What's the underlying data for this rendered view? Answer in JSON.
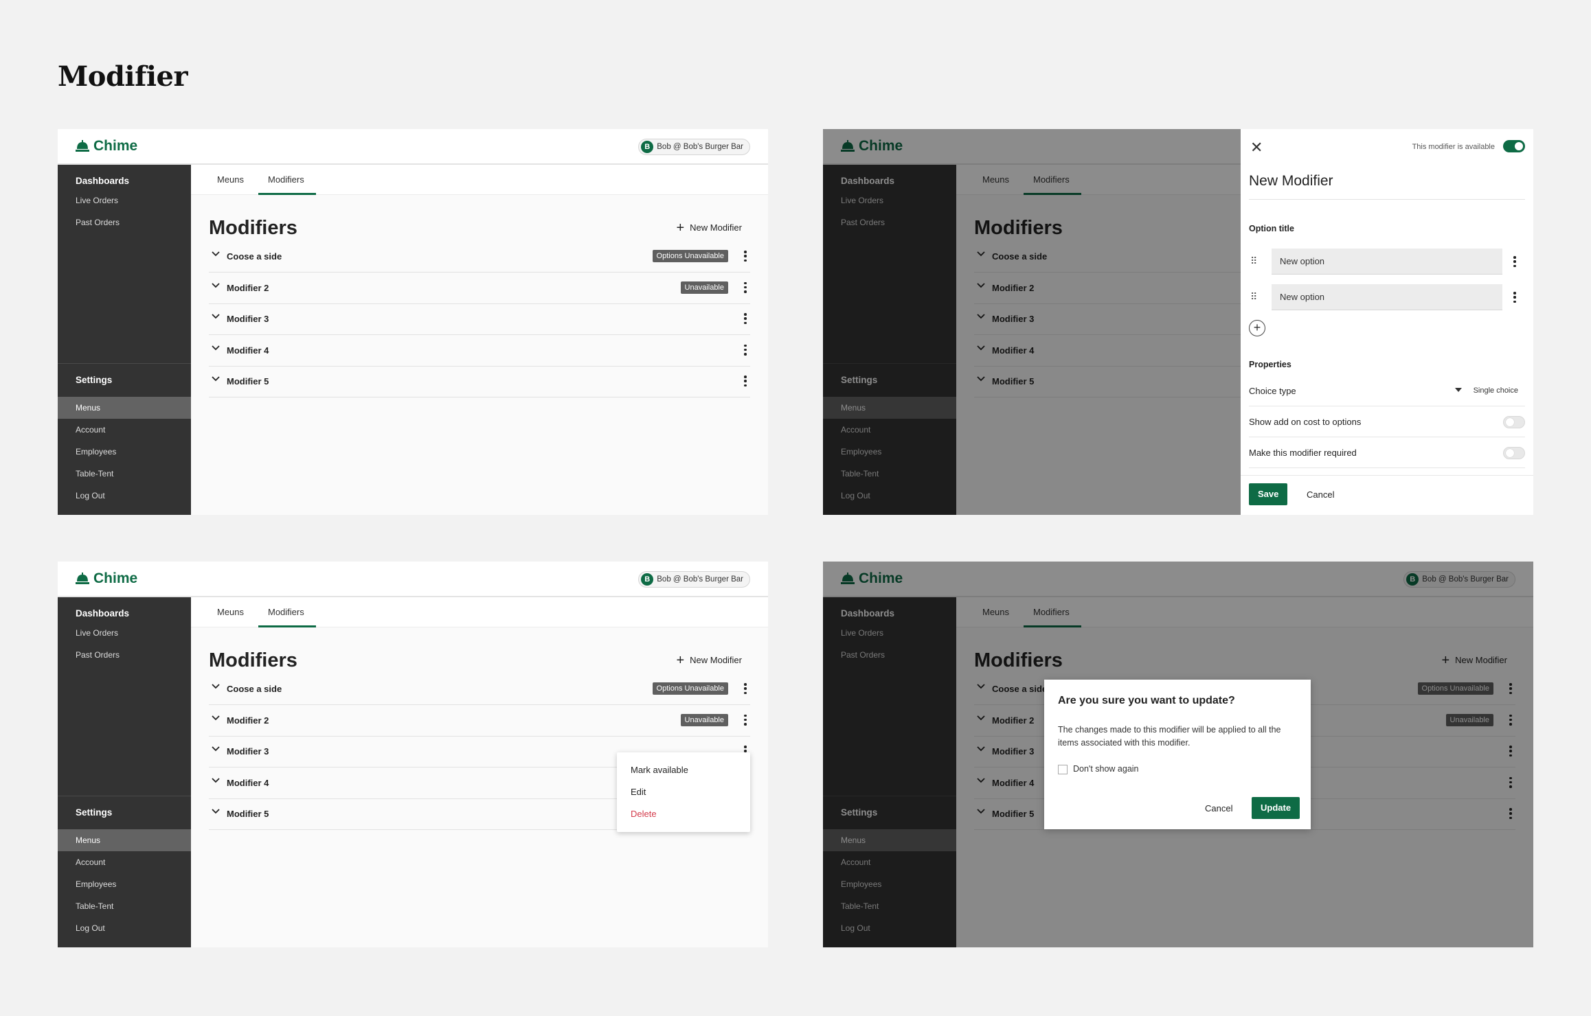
{
  "page_title": "Modifier",
  "app": {
    "brand": "Chime",
    "user_initial": "B",
    "user_label": "Bob @ Bob's Burger Bar"
  },
  "sidebar": {
    "dashboards_heading": "Dashboards",
    "dashboards_items": [
      {
        "label": "Live Orders"
      },
      {
        "label": "Past Orders"
      }
    ],
    "settings_heading": "Settings",
    "settings_items": [
      {
        "label": "Menus",
        "active": true
      },
      {
        "label": "Account"
      },
      {
        "label": "Employees"
      },
      {
        "label": "Table-Tent"
      },
      {
        "label": "Log Out"
      }
    ]
  },
  "tabs": [
    {
      "label": "Meuns"
    },
    {
      "label": "Modifiers",
      "active": true
    }
  ],
  "main": {
    "title": "Modifiers",
    "new_modifier_label": "New Modifier",
    "modifiers": [
      {
        "name": "Coose a side",
        "badge": "Options Unavailable"
      },
      {
        "name": "Modifier 2",
        "badge": "Unavailable"
      },
      {
        "name": "Modifier 3",
        "badge": ""
      },
      {
        "name": "Modifier 4",
        "badge": ""
      },
      {
        "name": "Modifier 5",
        "badge": ""
      }
    ]
  },
  "drawer": {
    "availability_label": "This modifier is available",
    "availability_on": true,
    "title": "New Modifier",
    "option_title_heading": "Option title",
    "options": [
      {
        "value": "New option"
      },
      {
        "value": "New option"
      }
    ],
    "properties_heading": "Properties",
    "choice_type_label": "Choice type",
    "choice_type_value": "Single choice",
    "show_add_on_label": "Show add on cost to options",
    "make_required_label": "Make this modifier required",
    "save_label": "Save",
    "cancel_label": "Cancel"
  },
  "context_menu": {
    "items": [
      {
        "label": "Mark available"
      },
      {
        "label": "Edit"
      },
      {
        "label": "Delete"
      }
    ]
  },
  "dialog": {
    "title": "Are you sure you want to update?",
    "body": "The changes made to this modifier will be applied to all the items associated with this modifier.",
    "checkbox_label": "Don't show again",
    "cancel_label": "Cancel",
    "update_label": "Update"
  },
  "colors": {
    "brand_green": "#0e6b45",
    "sidebar_bg": "#333333",
    "delete_red": "#d33a4a"
  }
}
